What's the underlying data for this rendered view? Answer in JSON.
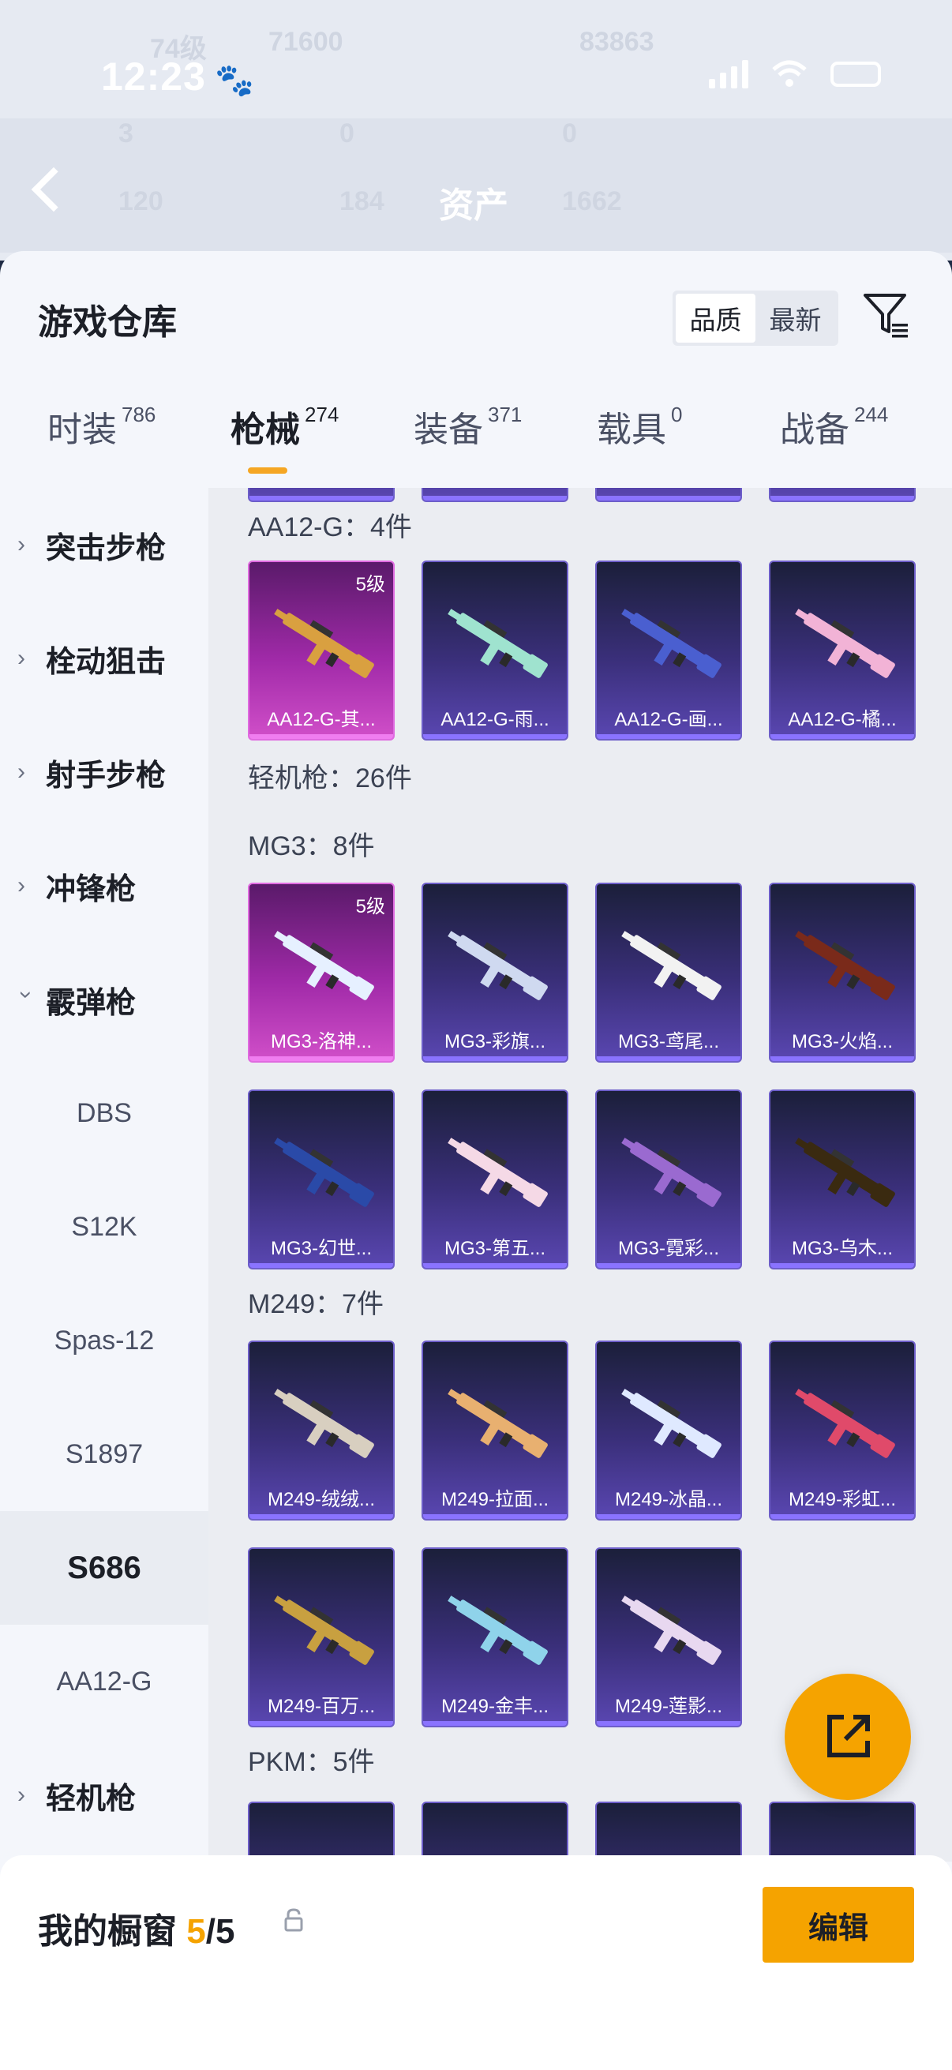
{
  "status_bar": {
    "time": "12:23"
  },
  "header_background": {
    "title": "资产",
    "faint_stats": [
      "74级",
      "71600",
      "83863",
      "3",
      "0",
      "0",
      "120",
      "184",
      "1662"
    ]
  },
  "warehouse": {
    "title": "游戏仓库",
    "sort_options": [
      "品质",
      "最新"
    ],
    "sort_selected": "品质"
  },
  "category_tabs": [
    {
      "label": "时装",
      "count": "786"
    },
    {
      "label": "枪械",
      "count": "274"
    },
    {
      "label": "装备",
      "count": "371"
    },
    {
      "label": "载具",
      "count": "0"
    },
    {
      "label": "战备",
      "count": "244"
    }
  ],
  "sidebar": {
    "groups": [
      "突击步枪",
      "栓动狙击",
      "射手步枪",
      "冲锋枪",
      "霰弹枪"
    ],
    "sub_items": [
      "DBS",
      "S12K",
      "Spas-12",
      "S1897",
      "S686",
      "AA12-G"
    ],
    "selected_sub": "S686",
    "after_group": "轻机枪"
  },
  "sections": {
    "aa12": {
      "title": "AA12-G：4件",
      "items": [
        {
          "name": "AA12-G-其...",
          "level": "5级",
          "rare": true,
          "color": "#d9a040"
        },
        {
          "name": "AA12-G-雨...",
          "level": "",
          "rare": false,
          "color": "#9fe3cf"
        },
        {
          "name": "AA12-G-画...",
          "level": "",
          "rare": false,
          "color": "#4a5fd0"
        },
        {
          "name": "AA12-G-橘...",
          "level": "",
          "rare": false,
          "color": "#f2b3d6"
        }
      ]
    },
    "lmg": {
      "title": "轻机枪：26件"
    },
    "mg3": {
      "title": "MG3：8件",
      "items": [
        {
          "name": "MG3-洛神...",
          "level": "5级",
          "rare": true,
          "color": "#e6f0ff"
        },
        {
          "name": "MG3-彩旗...",
          "level": "",
          "rare": false,
          "color": "#cfd9f0"
        },
        {
          "name": "MG3-鸢尾...",
          "level": "",
          "rare": false,
          "color": "#f2f2f2"
        },
        {
          "name": "MG3-火焰...",
          "level": "",
          "rare": false,
          "color": "#7a2a1a"
        },
        {
          "name": "MG3-幻世...",
          "level": "",
          "rare": false,
          "color": "#2a4aa8"
        },
        {
          "name": "MG3-第五...",
          "level": "",
          "rare": false,
          "color": "#f5d9e6"
        },
        {
          "name": "MG3-霓彩...",
          "level": "",
          "rare": false,
          "color": "#9a6ad0"
        },
        {
          "name": "MG3-乌木...",
          "level": "",
          "rare": false,
          "color": "#3a2a10"
        }
      ]
    },
    "m249": {
      "title": "M249：7件",
      "items": [
        {
          "name": "M249-绒绒...",
          "level": "",
          "rare": false,
          "color": "#d8cfc0"
        },
        {
          "name": "M249-拉面...",
          "level": "",
          "rare": false,
          "color": "#e8b070"
        },
        {
          "name": "M249-冰晶...",
          "level": "",
          "rare": false,
          "color": "#dfe9ff"
        },
        {
          "name": "M249-彩虹...",
          "level": "",
          "rare": false,
          "color": "#e04a6a"
        },
        {
          "name": "M249-百万...",
          "level": "",
          "rare": false,
          "color": "#c8a040"
        },
        {
          "name": "M249-金丰...",
          "level": "",
          "rare": false,
          "color": "#8fd3ea"
        },
        {
          "name": "M249-莲影...",
          "level": "",
          "rare": false,
          "color": "#e8d8f0"
        }
      ]
    },
    "pkm": {
      "title": "PKM：5件"
    }
  },
  "showcase": {
    "label": "我的橱窗",
    "current": "5",
    "total": "/5",
    "edit_label": "编辑"
  },
  "colors": {
    "accent": "#f5a300",
    "rare_card": "#c23ec0",
    "normal_card": "#3a2f7a"
  }
}
